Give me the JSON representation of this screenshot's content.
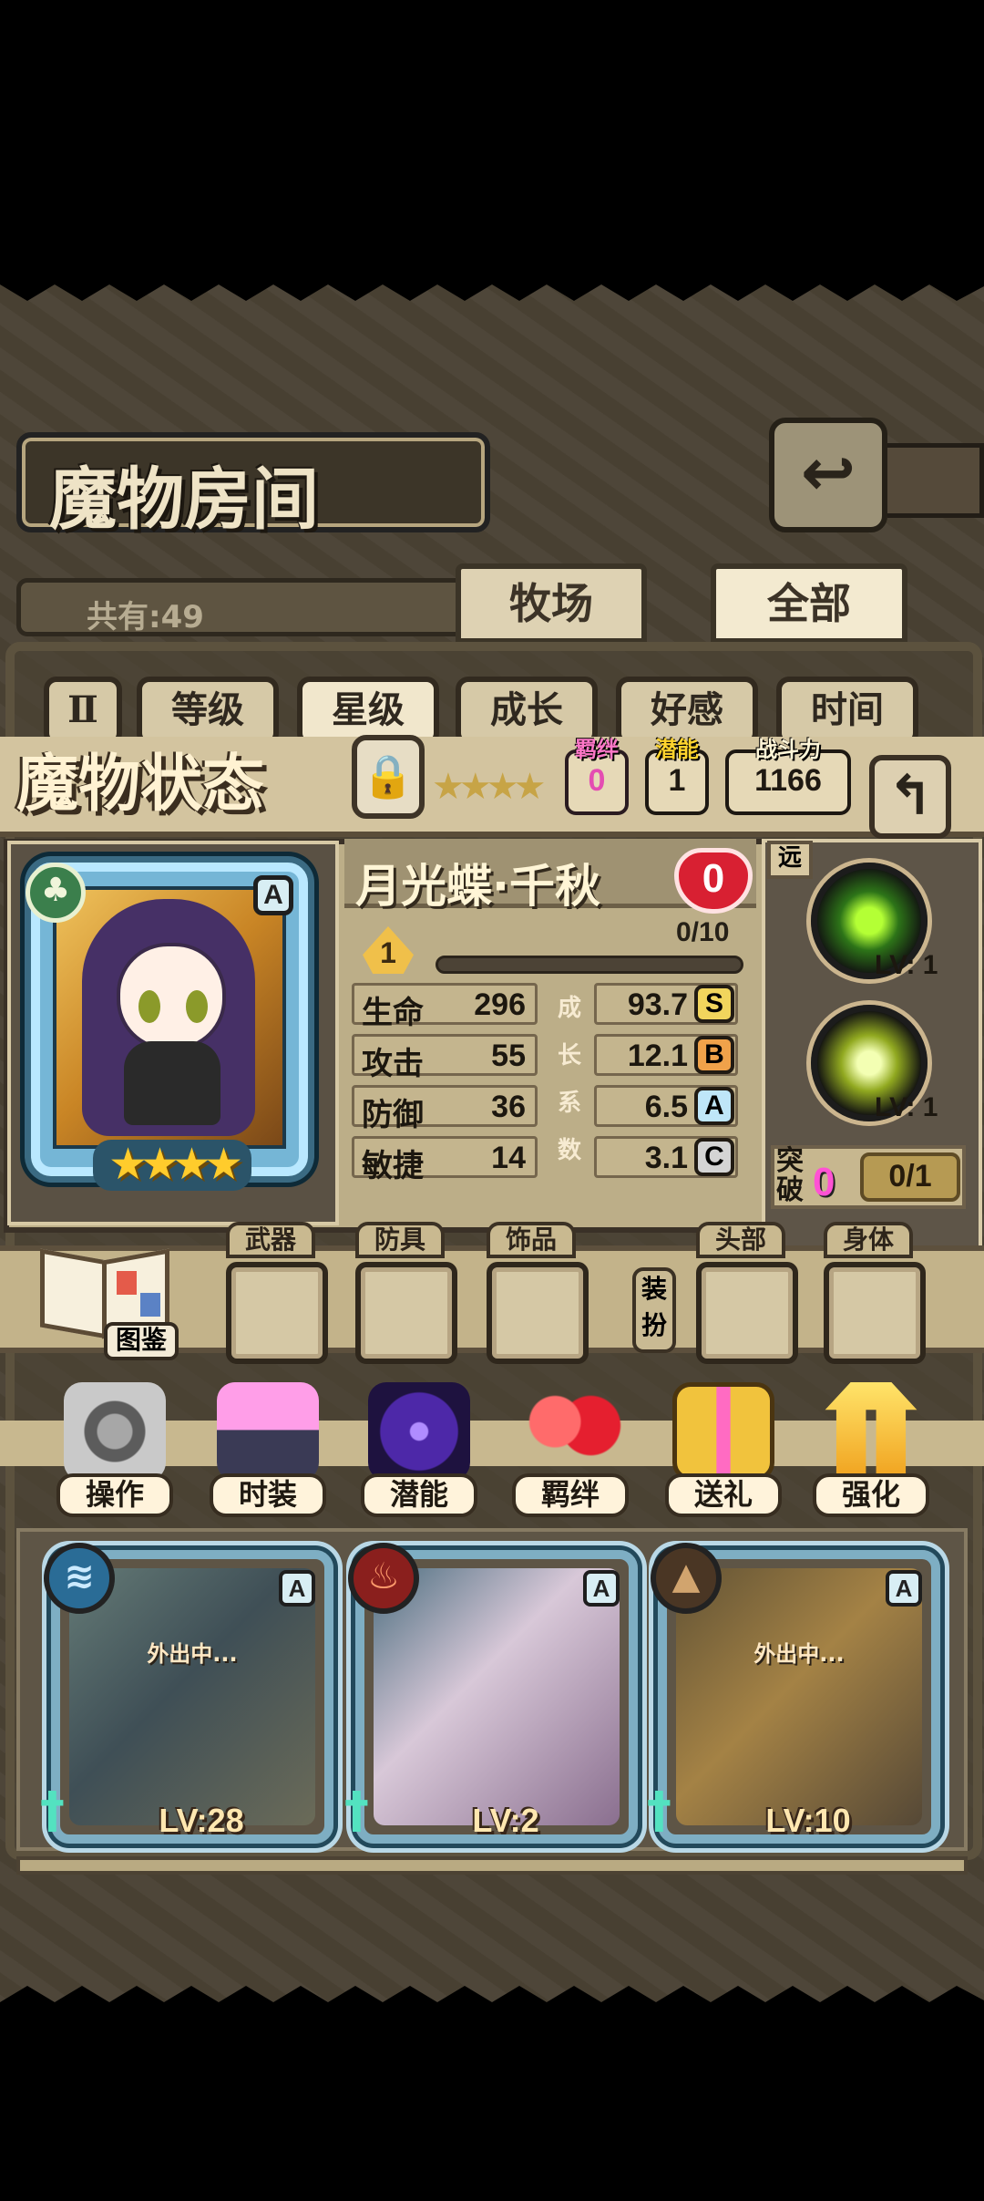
{
  "header": {
    "title": "魔物房间",
    "back_icon": "return-arrow-icon"
  },
  "collection": {
    "count_text": "共有:49"
  },
  "tabs": [
    {
      "label": "牧场"
    },
    {
      "label": "全部"
    }
  ],
  "sort": {
    "icon": "pause-sort-icon",
    "items": [
      {
        "label": "等级"
      },
      {
        "label": "星级"
      },
      {
        "label": "成长"
      },
      {
        "label": "好感"
      },
      {
        "label": "时间"
      }
    ],
    "active": "星级"
  },
  "status": {
    "title": "魔物状态",
    "lock_icon": "padlock-icon",
    "bond": {
      "label": "羁绊",
      "value": "0"
    },
    "potential": {
      "label": "潜能",
      "value": "1"
    },
    "power": {
      "label": "战斗力",
      "value": "1166"
    },
    "return_icon": "return-arrow-icon"
  },
  "monster": {
    "name": "月光蝶·千秋",
    "affection": "0",
    "rank": "A",
    "stars": 4,
    "level": "1",
    "xp_text": "0/10",
    "xp_ratio": 0,
    "element_icon": "leaf-element-icon",
    "range": "远"
  },
  "stats": [
    {
      "label": "生命",
      "value": "296",
      "growth": "93.7",
      "grade": "S",
      "grade_color": "#f1d55d"
    },
    {
      "label": "攻击",
      "value": "55",
      "growth": "12.1",
      "grade": "B",
      "grade_color": "#f0a24a"
    },
    {
      "label": "防御",
      "value": "36",
      "growth": "6.5",
      "grade": "A",
      "grade_color": "#bfe6f8"
    },
    {
      "label": "敏捷",
      "value": "14",
      "growth": "3.1",
      "grade": "C",
      "grade_color": "#d4d4d4"
    }
  ],
  "growth_vertical": [
    "成",
    "长",
    "系",
    "数"
  ],
  "skills": [
    {
      "icon": "butterfly-skill-icon",
      "level": "LV: 1"
    },
    {
      "icon": "shield-skill-icon",
      "level": "LV: 1"
    }
  ],
  "breakthrough": {
    "label": "突破",
    "count": "0",
    "value": "0/1"
  },
  "equipment": {
    "book_label": "图鉴",
    "slots": [
      {
        "label": "武器"
      },
      {
        "label": "防具"
      },
      {
        "label": "饰品"
      },
      {
        "label": "头部"
      },
      {
        "label": "身体"
      }
    ],
    "costume_label": "装扮"
  },
  "actions": [
    {
      "label": "操作",
      "icon": "gear-icon"
    },
    {
      "label": "时装",
      "icon": "outfit-icon"
    },
    {
      "label": "潜能",
      "icon": "shadow-demon-icon"
    },
    {
      "label": "羁绊",
      "icon": "hearts-icon"
    },
    {
      "label": "送礼",
      "icon": "gift-icon"
    },
    {
      "label": "强化",
      "icon": "upgrade-arrows-icon"
    }
  ],
  "monster_list": [
    {
      "level": "LV:28",
      "state": "外出中...",
      "element": "water-element-icon",
      "rank": "A"
    },
    {
      "level": "LV:2",
      "state": "",
      "element": "fire-element-icon",
      "rank": "A"
    },
    {
      "level": "LV:10",
      "state": "外出中...",
      "element": "earth-element-icon",
      "rank": "A"
    }
  ]
}
